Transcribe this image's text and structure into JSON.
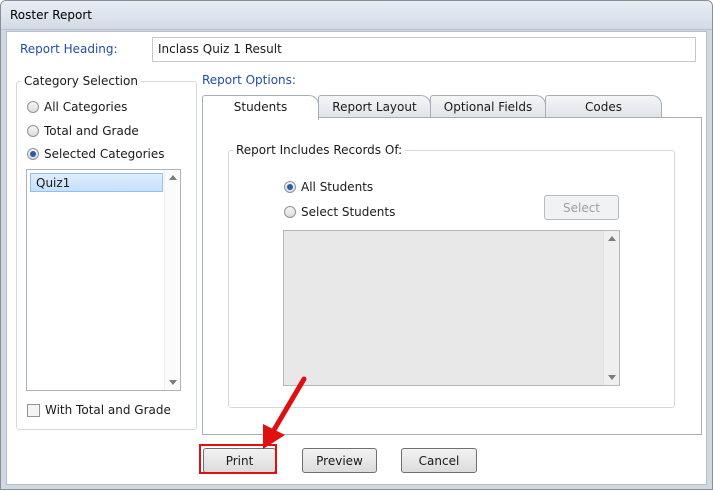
{
  "window": {
    "title": "Roster Report"
  },
  "report_heading": {
    "label": "Report Heading:",
    "value": "Inclass Quiz 1 Result"
  },
  "category_selection": {
    "title": "Category Selection",
    "options": [
      {
        "label": "All Categories",
        "checked": false
      },
      {
        "label": "Total and Grade",
        "checked": false
      },
      {
        "label": "Selected Categories",
        "checked": true
      }
    ],
    "list_items": [
      "Quiz1"
    ],
    "with_total_label": "With Total and Grade"
  },
  "report_options": {
    "label": "Report Options:",
    "tabs": [
      "Students",
      "Report Layout",
      "Optional Fields",
      "Codes"
    ],
    "active_tab": "Students",
    "students": {
      "group_title": "Report Includes Records Of:",
      "options": [
        {
          "label": "All Students",
          "checked": true
        },
        {
          "label": "Select Students",
          "checked": false
        }
      ],
      "select_button": "Select"
    }
  },
  "buttons": {
    "print": "Print",
    "preview": "Preview",
    "cancel": "Cancel"
  },
  "colors": {
    "annotation": "#e01010",
    "label_blue": "#1f4e9e"
  }
}
